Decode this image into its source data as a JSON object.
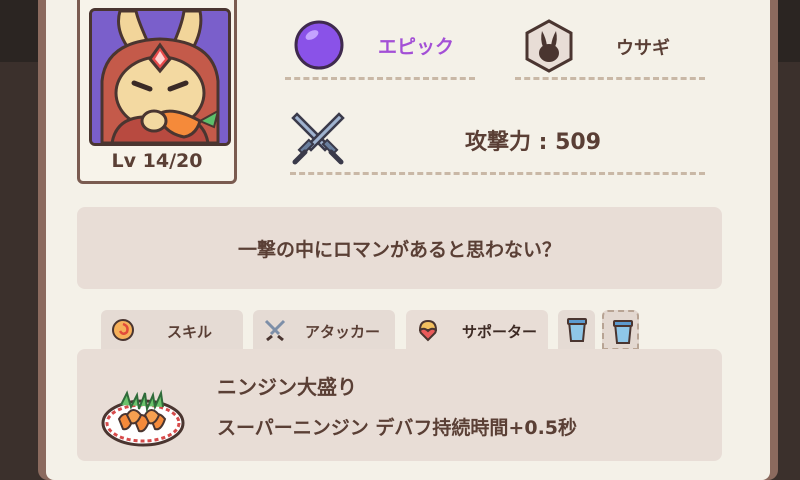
{
  "character": {
    "level": "Lv 14/20",
    "rarity": "エピック",
    "species": "ウサギ",
    "attack": "攻撃力 : 509",
    "quote": "一撃の中にロマンがあると思わない？"
  },
  "tabs": [
    {
      "label": "スキル",
      "icon": "swirl-icon"
    },
    {
      "label": "アタッカー",
      "icon": "crossed-swords-icon"
    },
    {
      "label": "サポーター",
      "icon": "heart-helmet-icon"
    },
    {
      "label": "",
      "icon": "cup-icon"
    },
    {
      "label": "",
      "icon": "cup-icon"
    }
  ],
  "skill": {
    "name": "ニンジン大盛り",
    "description": "スーパーニンジン  デバフ持続時間+0.5秒"
  },
  "colors": {
    "rarity": "#a34fd6",
    "text": "#5a3f35",
    "panel": "#f4f1e8",
    "box": "#e8ddd6"
  }
}
